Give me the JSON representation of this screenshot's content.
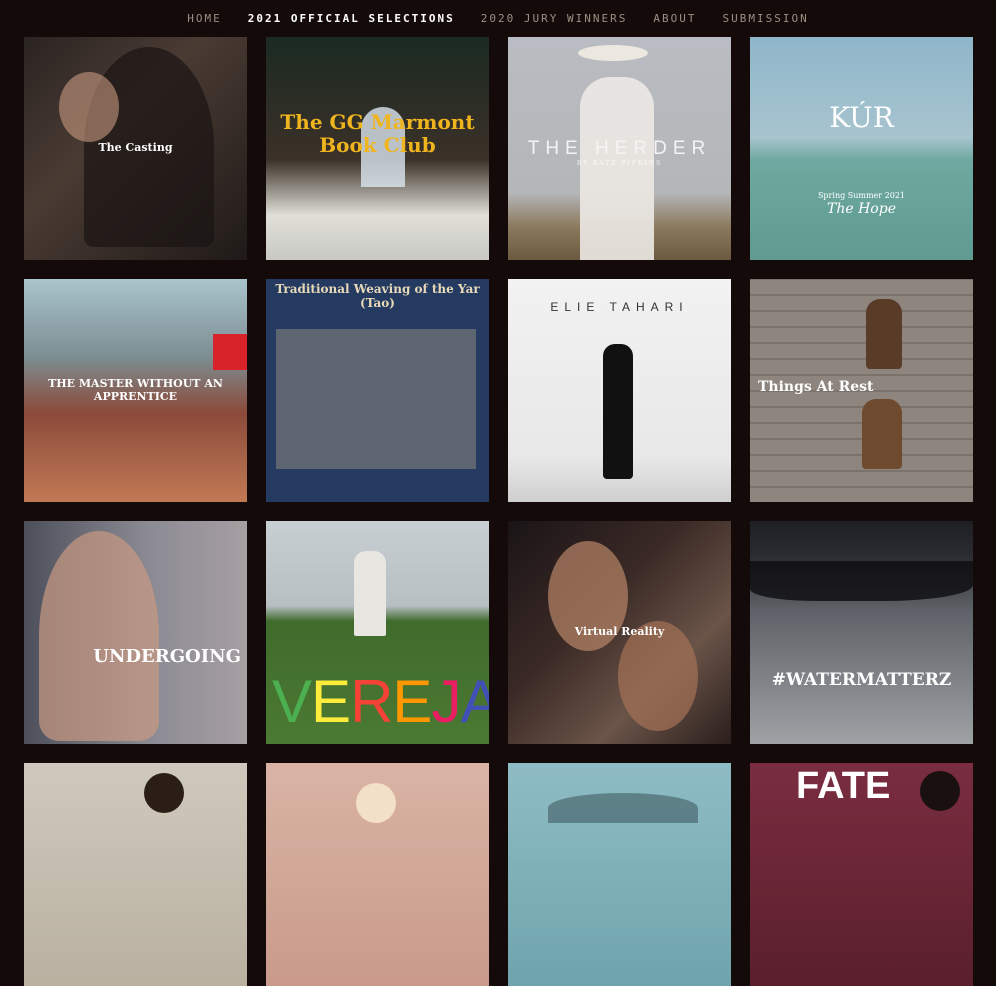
{
  "nav": {
    "items": [
      {
        "label": "HOME"
      },
      {
        "label": "2021 OFFICIAL SELECTIONS"
      },
      {
        "label": "2020 JURY WINNERS"
      },
      {
        "label": "ABOUT"
      },
      {
        "label": "SUBMISSION"
      }
    ],
    "active": "2021 OFFICIAL SELECTIONS"
  },
  "films": [
    {
      "title": "The Casting"
    },
    {
      "title": "The GG Marmont Book Club"
    },
    {
      "title": "THE HERDER",
      "credit": "BY KATE PIPKINS"
    },
    {
      "title": "KÚR",
      "season": "Spring Summer 2021",
      "subtitle": "The Hope"
    },
    {
      "title": "THE MASTER WITHOUT AN APPRENTICE"
    },
    {
      "title": "Traditional Weaving of the Yar (Tao)"
    },
    {
      "title": "ELIE TAHARI"
    },
    {
      "title": "Things At Rest"
    },
    {
      "title": "UNDERGOING"
    },
    {
      "title": "VEREJA"
    },
    {
      "title": "Virtual Reality"
    },
    {
      "title": "#WATERMATTERZ"
    },
    {
      "title": ""
    },
    {
      "title": ""
    },
    {
      "title": ""
    },
    {
      "title": "FATE"
    }
  ],
  "colors": {
    "background": "#150a0a",
    "nav_text": "#9c8f82",
    "nav_active": "#ffffff",
    "gg_marmont_title": "#f0b51e"
  }
}
